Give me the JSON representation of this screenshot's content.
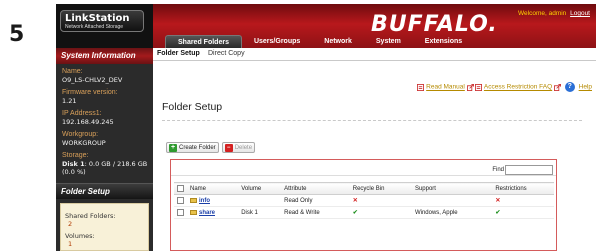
{
  "step_number": "5",
  "logo": {
    "title": "LinkStation",
    "subtitle": "Network Attached Storage"
  },
  "brand": "BUFFALO.",
  "header": {
    "welcome": "Welcome, admin",
    "logout": "Logout"
  },
  "nav": {
    "items": [
      "Shared Folders",
      "Users/Groups",
      "Network",
      "System",
      "Extensions"
    ],
    "active": "Shared Folders"
  },
  "subnav": {
    "tabs": [
      "Folder Setup",
      "Direct Copy"
    ],
    "active": "Folder Setup"
  },
  "help": {
    "read_manual": "Read Manual",
    "faq": "Access Restriction FAQ",
    "help": "Help"
  },
  "system_info": {
    "header": "System Information",
    "items": [
      {
        "label": "Name:",
        "value": "O9_LS-CHLV2_DEV"
      },
      {
        "label": "Firmware version:",
        "value": "1.21"
      },
      {
        "label": "IP Address1:",
        "value": "192.168.49.245"
      },
      {
        "label": "Workgroup:",
        "value": "WORKGROUP"
      }
    ],
    "storage": {
      "label": "Storage:",
      "disk_label": "Disk 1",
      "disk_value": ": 0.0 GB / 218.6 GB",
      "percent": "(0.0 %)"
    }
  },
  "folder_setup_panel": {
    "header": "Folder Setup",
    "shared_folders_label": "Shared Folders:",
    "shared_folders_value": "2",
    "volumes_label": "Volumes:",
    "volumes_value": "1"
  },
  "main": {
    "title": "Folder Setup",
    "create_button": "Create Folder",
    "delete_button": "Delete",
    "find_label": "Find",
    "find_value": "",
    "columns": [
      "Name",
      "Volume",
      "Attribute",
      "Recycle Bin",
      "Support",
      "Restrictions"
    ],
    "rows": [
      {
        "name": "info",
        "volume": "",
        "attribute": "Read Only",
        "recycle": "✕",
        "support": "",
        "restrictions": "✕"
      },
      {
        "name": "share",
        "volume": "Disk 1",
        "attribute": "Read & Write",
        "recycle": "✔",
        "support": "Windows, Apple",
        "restrictions": "✔"
      }
    ]
  },
  "colors": {
    "brand_red": "#b8181c",
    "accent_orange": "#d9a05a",
    "link_blue": "#1b3fa8",
    "ok_green": "#1e8f1e",
    "no_red": "#d42121"
  }
}
